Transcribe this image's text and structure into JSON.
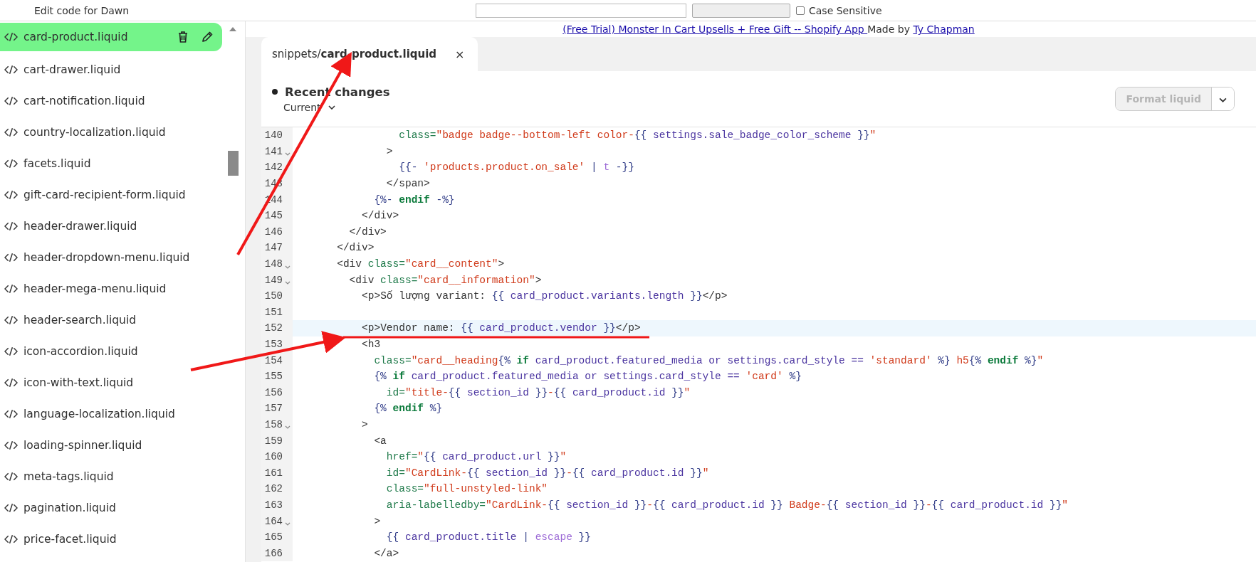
{
  "top_bar": {
    "title": "Edit code for Dawn",
    "case_sensitive": {
      "label": "Case Sensitive",
      "checked": false
    }
  },
  "sidebar": {
    "items": [
      {
        "label": "card-product.liquid",
        "selected": true
      },
      {
        "label": "cart-drawer.liquid",
        "selected": false
      },
      {
        "label": "cart-notification.liquid",
        "selected": false
      },
      {
        "label": "country-localization.liquid",
        "selected": false
      },
      {
        "label": "facets.liquid",
        "selected": false
      },
      {
        "label": "gift-card-recipient-form.liquid",
        "selected": false
      },
      {
        "label": "header-drawer.liquid",
        "selected": false
      },
      {
        "label": "header-dropdown-menu.liquid",
        "selected": false
      },
      {
        "label": "header-mega-menu.liquid",
        "selected": false
      },
      {
        "label": "header-search.liquid",
        "selected": false
      },
      {
        "label": "icon-accordion.liquid",
        "selected": false
      },
      {
        "label": "icon-with-text.liquid",
        "selected": false
      },
      {
        "label": "language-localization.liquid",
        "selected": false
      },
      {
        "label": "loading-spinner.liquid",
        "selected": false
      },
      {
        "label": "meta-tags.liquid",
        "selected": false
      },
      {
        "label": "pagination.liquid",
        "selected": false
      },
      {
        "label": "price-facet.liquid",
        "selected": false
      }
    ]
  },
  "credit": {
    "app_link": "(Free Trial) Monster In Cart Upsells + Free Gift -- Shopify App ",
    "made_by": "Made by ",
    "author_link": "Ty Chapman"
  },
  "tabs": [
    {
      "label": "snippets/**card-product.liquid**",
      "close": "×",
      "selected": true
    }
  ],
  "editor_header": {
    "title": "Recent changes",
    "version": "Current",
    "format_button": {
      "label": "Format liquid",
      "disabled": true
    }
  },
  "code_lines": [
    {
      "no": "140",
      "fold": false,
      "highlight": false,
      "segments": [
        {
          "kind": "attr",
          "t": "                class="
        },
        {
          "kind": "str",
          "t": "\"badge badge--bottom-left color-"
        },
        {
          "kind": "delim",
          "t": "{{"
        },
        {
          "kind": "var",
          "t": " settings.sale_badge_color_scheme "
        },
        {
          "kind": "delim",
          "t": "}}"
        },
        {
          "kind": "str",
          "t": "\""
        }
      ]
    },
    {
      "no": "141",
      "fold": true,
      "highlight": false,
      "segments": [
        {
          "kind": "tag",
          "t": "              >"
        }
      ]
    },
    {
      "no": "142",
      "fold": false,
      "highlight": false,
      "segments": [
        {
          "kind": "delim",
          "t": "                {{-"
        },
        {
          "kind": "str",
          "t": " 'products.product.on_sale'"
        },
        {
          "kind": "delim",
          "t": " |"
        },
        {
          "kind": "filter",
          "t": " t"
        },
        {
          "kind": "delim",
          "t": " -}}"
        }
      ]
    },
    {
      "no": "143",
      "fold": false,
      "highlight": false,
      "segments": [
        {
          "kind": "tag",
          "t": "              </span>"
        }
      ]
    },
    {
      "no": "144",
      "fold": false,
      "highlight": false,
      "segments": [
        {
          "kind": "delim",
          "t": "            {%-"
        },
        {
          "kind": "kw",
          "t": " endif"
        },
        {
          "kind": "delim",
          "t": " -%}"
        }
      ]
    },
    {
      "no": "145",
      "fold": false,
      "highlight": false,
      "segments": [
        {
          "kind": "tag",
          "t": "          </div>"
        }
      ]
    },
    {
      "no": "146",
      "fold": false,
      "highlight": false,
      "segments": [
        {
          "kind": "tag",
          "t": "        </div>"
        }
      ]
    },
    {
      "no": "147",
      "fold": false,
      "highlight": false,
      "segments": [
        {
          "kind": "tag",
          "t": "      </div>"
        }
      ]
    },
    {
      "no": "148",
      "fold": true,
      "highlight": false,
      "segments": [
        {
          "kind": "tag",
          "t": "      <div"
        },
        {
          "kind": "attr",
          "t": " class="
        },
        {
          "kind": "str",
          "t": "\"card__content\""
        },
        {
          "kind": "tag",
          "t": ">"
        }
      ]
    },
    {
      "no": "149",
      "fold": true,
      "highlight": false,
      "segments": [
        {
          "kind": "tag",
          "t": "        <div"
        },
        {
          "kind": "attr",
          "t": " class="
        },
        {
          "kind": "str",
          "t": "\"card__information\""
        },
        {
          "kind": "tag",
          "t": ">"
        }
      ]
    },
    {
      "no": "150",
      "fold": false,
      "highlight": false,
      "segments": [
        {
          "kind": "tag",
          "t": "          <p>"
        },
        {
          "kind": "text",
          "t": "Số lượng variant: "
        },
        {
          "kind": "delim",
          "t": "{{"
        },
        {
          "kind": "var",
          "t": " card_product.variants.length "
        },
        {
          "kind": "delim",
          "t": "}}"
        },
        {
          "kind": "tag",
          "t": "</p>"
        }
      ]
    },
    {
      "no": "151",
      "fold": false,
      "highlight": false
    },
    {
      "no": "152",
      "fold": false,
      "highlight": true,
      "segments": [
        {
          "kind": "tag",
          "t": "          <p>"
        },
        {
          "kind": "text",
          "t": "Vendor name: "
        },
        {
          "kind": "delim",
          "t": "{{"
        },
        {
          "kind": "var",
          "t": " card_product.vendor "
        },
        {
          "kind": "delim",
          "t": "}}"
        },
        {
          "kind": "tag",
          "t": "</p>"
        }
      ]
    },
    {
      "no": "153",
      "fold": false,
      "highlight": false,
      "segments": [
        {
          "kind": "tag",
          "t": "          <h3"
        }
      ]
    },
    {
      "no": "154",
      "fold": false,
      "highlight": false,
      "segments": [
        {
          "kind": "attr",
          "t": "            class="
        },
        {
          "kind": "str",
          "t": "\"card__heading"
        },
        {
          "kind": "delim",
          "t": "{%"
        },
        {
          "kind": "kw",
          "t": " if"
        },
        {
          "kind": "var",
          "t": " card_product.featured_media or settings.card_style == "
        },
        {
          "kind": "str",
          "t": "'standard'"
        },
        {
          "kind": "delim",
          "t": " %}"
        },
        {
          "kind": "str",
          "t": " h5"
        },
        {
          "kind": "delim",
          "t": "{%"
        },
        {
          "kind": "kw",
          "t": " endif"
        },
        {
          "kind": "delim",
          "t": " %}"
        },
        {
          "kind": "str",
          "t": "\""
        }
      ]
    },
    {
      "no": "155",
      "fold": false,
      "highlight": false,
      "segments": [
        {
          "kind": "delim",
          "t": "            {%"
        },
        {
          "kind": "kw",
          "t": " if"
        },
        {
          "kind": "var",
          "t": " card_product.featured_media or settings.card_style == "
        },
        {
          "kind": "str",
          "t": "'card'"
        },
        {
          "kind": "delim",
          "t": " %}"
        }
      ]
    },
    {
      "no": "156",
      "fold": false,
      "highlight": false,
      "segments": [
        {
          "kind": "attr",
          "t": "              id="
        },
        {
          "kind": "str",
          "t": "\"title-"
        },
        {
          "kind": "delim",
          "t": "{{"
        },
        {
          "kind": "var",
          "t": " section_id "
        },
        {
          "kind": "delim",
          "t": "}}"
        },
        {
          "kind": "str",
          "t": "-"
        },
        {
          "kind": "delim",
          "t": "{{"
        },
        {
          "kind": "var",
          "t": " card_product.id "
        },
        {
          "kind": "delim",
          "t": "}}"
        },
        {
          "kind": "str",
          "t": "\""
        }
      ]
    },
    {
      "no": "157",
      "fold": false,
      "highlight": false,
      "segments": [
        {
          "kind": "delim",
          "t": "            {%"
        },
        {
          "kind": "kw",
          "t": " endif"
        },
        {
          "kind": "delim",
          "t": " %}"
        }
      ]
    },
    {
      "no": "158",
      "fold": true,
      "highlight": false,
      "segments": [
        {
          "kind": "tag",
          "t": "          >"
        }
      ]
    },
    {
      "no": "159",
      "fold": false,
      "highlight": false,
      "segments": [
        {
          "kind": "tag",
          "t": "            <a"
        }
      ]
    },
    {
      "no": "160",
      "fold": false,
      "highlight": false,
      "segments": [
        {
          "kind": "attr",
          "t": "              href="
        },
        {
          "kind": "str",
          "t": "\""
        },
        {
          "kind": "delim",
          "t": "{{"
        },
        {
          "kind": "var",
          "t": " card_product.url "
        },
        {
          "kind": "delim",
          "t": "}}"
        },
        {
          "kind": "str",
          "t": "\""
        }
      ]
    },
    {
      "no": "161",
      "fold": false,
      "highlight": false,
      "segments": [
        {
          "kind": "attr",
          "t": "              id="
        },
        {
          "kind": "str",
          "t": "\"CardLink-"
        },
        {
          "kind": "delim",
          "t": "{{"
        },
        {
          "kind": "var",
          "t": " section_id "
        },
        {
          "kind": "delim",
          "t": "}}"
        },
        {
          "kind": "str",
          "t": "-"
        },
        {
          "kind": "delim",
          "t": "{{"
        },
        {
          "kind": "var",
          "t": " card_product.id "
        },
        {
          "kind": "delim",
          "t": "}}"
        },
        {
          "kind": "str",
          "t": "\""
        }
      ]
    },
    {
      "no": "162",
      "fold": false,
      "highlight": false,
      "segments": [
        {
          "kind": "attr",
          "t": "              class="
        },
        {
          "kind": "str",
          "t": "\"full-unstyled-link\""
        }
      ]
    },
    {
      "no": "163",
      "fold": false,
      "highlight": false,
      "segments": [
        {
          "kind": "attr",
          "t": "              aria-labelledby="
        },
        {
          "kind": "str",
          "t": "\"CardLink-"
        },
        {
          "kind": "delim",
          "t": "{{"
        },
        {
          "kind": "var",
          "t": " section_id "
        },
        {
          "kind": "delim",
          "t": "}}"
        },
        {
          "kind": "str",
          "t": "-"
        },
        {
          "kind": "delim",
          "t": "{{"
        },
        {
          "kind": "var",
          "t": " card_product.id "
        },
        {
          "kind": "delim",
          "t": "}}"
        },
        {
          "kind": "str",
          "t": " Badge-"
        },
        {
          "kind": "delim",
          "t": "{{"
        },
        {
          "kind": "var",
          "t": " section_id "
        },
        {
          "kind": "delim",
          "t": "}}"
        },
        {
          "kind": "str",
          "t": "-"
        },
        {
          "kind": "delim",
          "t": "{{"
        },
        {
          "kind": "var",
          "t": " card_product.id "
        },
        {
          "kind": "delim",
          "t": "}}"
        },
        {
          "kind": "str",
          "t": "\""
        }
      ]
    },
    {
      "no": "164",
      "fold": true,
      "highlight": false,
      "segments": [
        {
          "kind": "tag",
          "t": "            >"
        }
      ]
    },
    {
      "no": "165",
      "fold": false,
      "highlight": false,
      "segments": [
        {
          "kind": "delim",
          "t": "              {{"
        },
        {
          "kind": "var",
          "t": " card_product.title "
        },
        {
          "kind": "delim",
          "t": "|"
        },
        {
          "kind": "filter",
          "t": " escape"
        },
        {
          "kind": "delim",
          "t": " }}"
        }
      ]
    },
    {
      "no": "166",
      "fold": false,
      "highlight": false,
      "segments": [
        {
          "kind": "tag",
          "t": "            </a>"
        }
      ]
    }
  ],
  "annotations": [
    {
      "kind": "arrow"
    },
    {
      "kind": "arrow"
    },
    {
      "kind": "underline"
    }
  ]
}
